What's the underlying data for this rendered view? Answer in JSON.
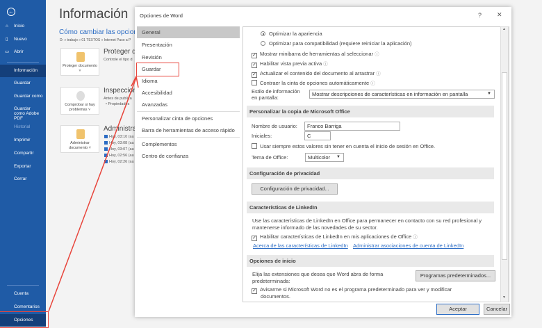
{
  "backstage": {
    "nav": [
      {
        "label": "Inicio",
        "icon": "home-icon"
      },
      {
        "label": "Nuevo",
        "icon": "new-document-icon"
      },
      {
        "label": "Abrir",
        "icon": "folder-open-icon"
      },
      {
        "label": "Información",
        "selected": true
      },
      {
        "label": "Guardar"
      },
      {
        "label": "Guardar como"
      },
      {
        "label": "Guardar como Adobe PDF"
      },
      {
        "label": "Historial",
        "disabled": true
      },
      {
        "label": "Imprimir"
      },
      {
        "label": "Compartir"
      },
      {
        "label": "Exportar"
      },
      {
        "label": "Cerrar"
      }
    ],
    "bottom": [
      "Cuenta",
      "Comentarios",
      "Opciones"
    ],
    "title": "Información",
    "doc_title": "Cómo cambiar las opcion",
    "path": "D: » trabajo » 01 TEXTOS » Internet Paso a P",
    "cards": [
      {
        "label": "Proteger documento ˅",
        "heading": "Proteger dc",
        "sub": "Controle el tipo d"
      },
      {
        "label": "Comprobar si hay problemas ˅",
        "heading": "Inspeccion",
        "sub": "Antes de publica",
        "bullet": "Propiedades"
      },
      {
        "label": "Administrar documento ˅",
        "heading": "Administrar",
        "versions": [
          "Hoy, 03:10 (au",
          "Hoy, 03:08 (au",
          "Hoy, 03:07 (au",
          "Hoy, 02:56 (au",
          "Hoy, 02:26 (au"
        ]
      }
    ]
  },
  "dialog": {
    "title": "Opciones de Word",
    "help": "?",
    "close": "✕",
    "nav": [
      "General",
      "Presentación",
      "Revisión",
      "Guardar",
      "Idioma",
      "Accesibilidad",
      "Avanzadas",
      "Personalizar cinta de opciones",
      "Barra de herramientas de acceso rápido",
      "Complementos",
      "Centro de confianza"
    ],
    "selected_nav": "General",
    "radios": [
      {
        "label": "Optimizar la apariencia",
        "checked": true
      },
      {
        "label": "Optimizar para compatibilidad (requiere reiniciar la aplicación)",
        "checked": false
      }
    ],
    "checks": [
      {
        "label": "Mostrar minibarra de herramientas al seleccionar",
        "checked": true
      },
      {
        "label": "Habilitar vista previa activa",
        "checked": true
      },
      {
        "label": "Actualizar el contenido del documento al arrastrar",
        "checked": true
      },
      {
        "label": "Contraer la cinta de opciones automáticamente",
        "checked": false
      }
    ],
    "screentip_label": "Estilo de información en pantalla:",
    "screentip_value": "Mostrar descripciones de características en información en pantalla",
    "personalize": {
      "header": "Personalizar la copia de Microsoft Office",
      "username_label": "Nombre de usuario:",
      "username": "Franco Barriga",
      "initials_label": "Iniciales:",
      "initials": "C",
      "always_use": "Usar siempre estos valores sin tener en cuenta el inicio de sesión en Office.",
      "theme_label": "Tema de Office:",
      "theme": "Multicolor"
    },
    "privacy": {
      "header": "Configuración de privacidad",
      "button": "Configuración de privacidad..."
    },
    "linkedin": {
      "header": "Características de LinkedIn",
      "text1": "Use las características de LinkedIn en Office para permanecer en contacto con su red profesional y",
      "text2": "mantenerse informado de las novedades de su sector.",
      "check": "Habilitar características de LinkedIn en mis aplicaciones de Office",
      "link1": "Acerca de las características de LinkedIn",
      "link2": "Administrar asociaciones de cuenta de LinkedIn"
    },
    "startup": {
      "header": "Opciones de inicio",
      "text1": "Elija las extensiones que desea que Word abra de forma",
      "text2": "predeterminada:",
      "button": "Programas predeterminados...",
      "check1": "Avisarme si Microsoft Word no es el programa predeterminado para ver y modificar",
      "check2": "documentos."
    },
    "ok": "Aceptar",
    "cancel": "Cancelar"
  },
  "colors": {
    "backstage_blue": "#1f5ba6",
    "annotation_red": "#e8453c",
    "link": "#2b6cc4"
  }
}
